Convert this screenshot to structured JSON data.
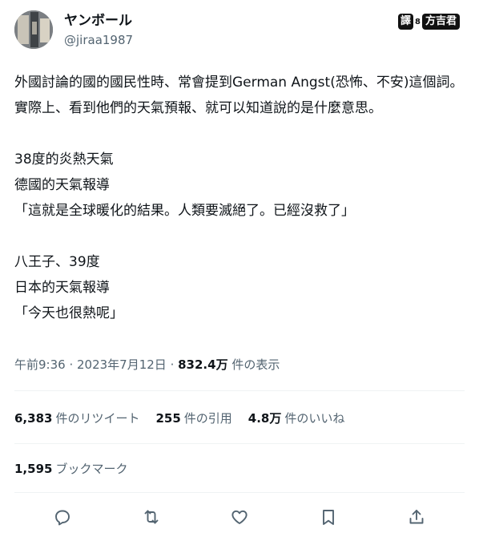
{
  "author": {
    "display_name": "ヤンボール",
    "handle": "@jiraa1987"
  },
  "watermark": {
    "badge": "譯",
    "dot": "8",
    "name": "方吉君"
  },
  "tweet": {
    "lines": [
      "外國討論的國的國民性時、常會提到German Angst(恐怖、不安)這個詞。實際上、看到他們的天氣預報、就可以知道說的是什麼意思。",
      "",
      "38度的炎熱天氣",
      "德國的天氣報導",
      "「這就是全球暖化的結果。人類要滅絕了。已經沒救了」",
      "",
      "八王子、39度",
      "日本的天氣報導",
      "「今天也很熱呢」"
    ]
  },
  "meta": {
    "time": "午前9:36",
    "sep1": " · ",
    "date": "2023年7月12日",
    "sep2": " · ",
    "views_count": "832.4万",
    "views_label": " 件の表示"
  },
  "stats": {
    "retweets_count": "6,383",
    "retweets_label": "件のリツイート",
    "quotes_count": "255",
    "quotes_label": "件の引用",
    "likes_count": "4.8万",
    "likes_label": "件のいいね",
    "bookmarks_count": "1,595",
    "bookmarks_label": "ブックマーク"
  },
  "actions": [
    "reply-icon",
    "retweet-icon",
    "like-icon",
    "bookmark-icon",
    "share-icon"
  ]
}
